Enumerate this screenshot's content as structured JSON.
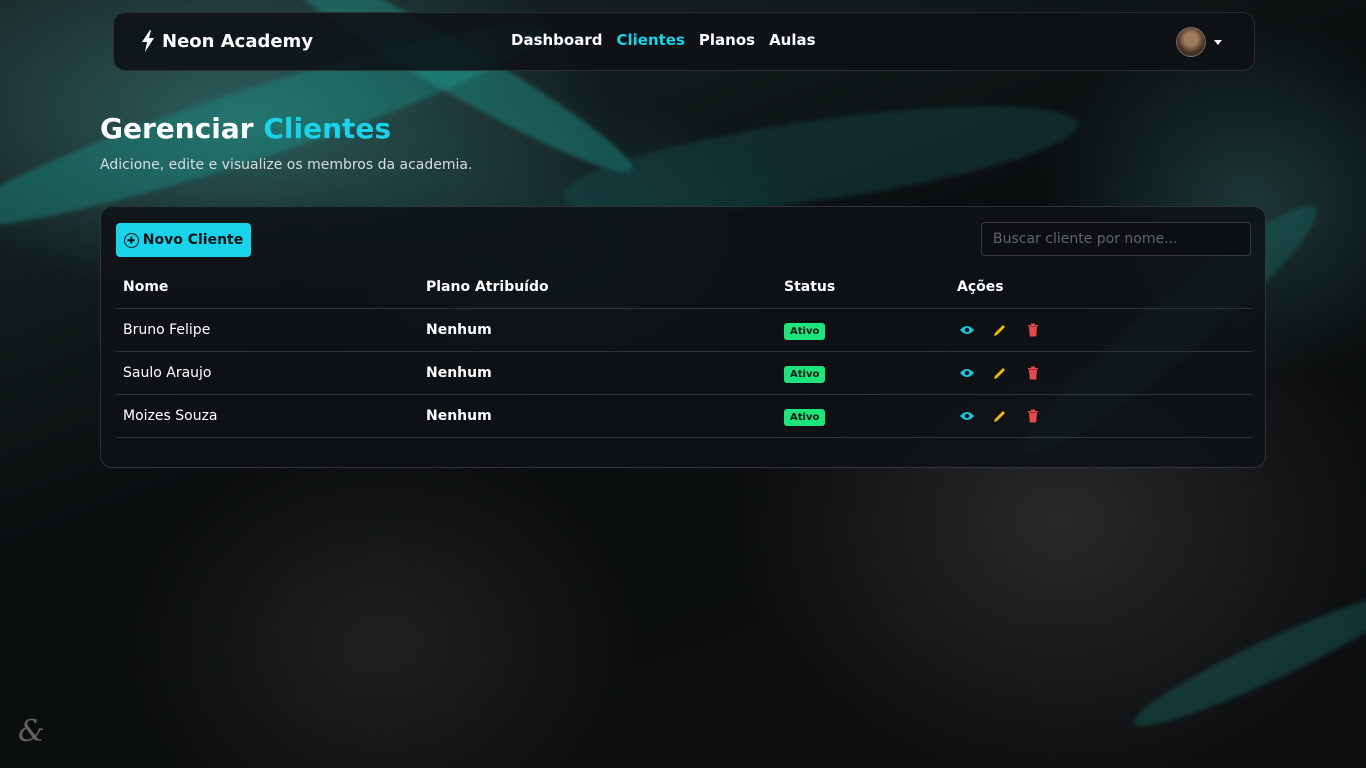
{
  "nav": {
    "brand": "Neon Academy",
    "links": [
      {
        "label": "Dashboard",
        "active": false
      },
      {
        "label": "Clientes",
        "active": true
      },
      {
        "label": "Planos",
        "active": false
      },
      {
        "label": "Aulas",
        "active": false
      }
    ]
  },
  "header": {
    "title_main": "Gerenciar",
    "title_accent": "Clientes",
    "subtitle": "Adicione, edite e visualize os membros da academia."
  },
  "toolbar": {
    "new_button": "Novo Cliente",
    "search_placeholder": "Buscar cliente por nome..."
  },
  "table": {
    "columns": [
      "Nome",
      "Plano Atribuído",
      "Status",
      "Ações"
    ],
    "rows": [
      {
        "name": "Bruno Felipe",
        "plan": "Nenhum",
        "status": "Ativo"
      },
      {
        "name": "Saulo Araujo",
        "plan": "Nenhum",
        "status": "Ativo"
      },
      {
        "name": "Moizes Souza",
        "plan": "Nenhum",
        "status": "Ativo"
      }
    ]
  },
  "icons": {
    "view": "eye-icon",
    "edit": "pencil-icon",
    "delete": "trash-icon"
  },
  "colors": {
    "accent": "#19d3ea",
    "status_active": "#1de57c",
    "view_icon": "#19c6e0",
    "edit_icon": "#f0b90b",
    "delete_icon": "#e5484d"
  }
}
